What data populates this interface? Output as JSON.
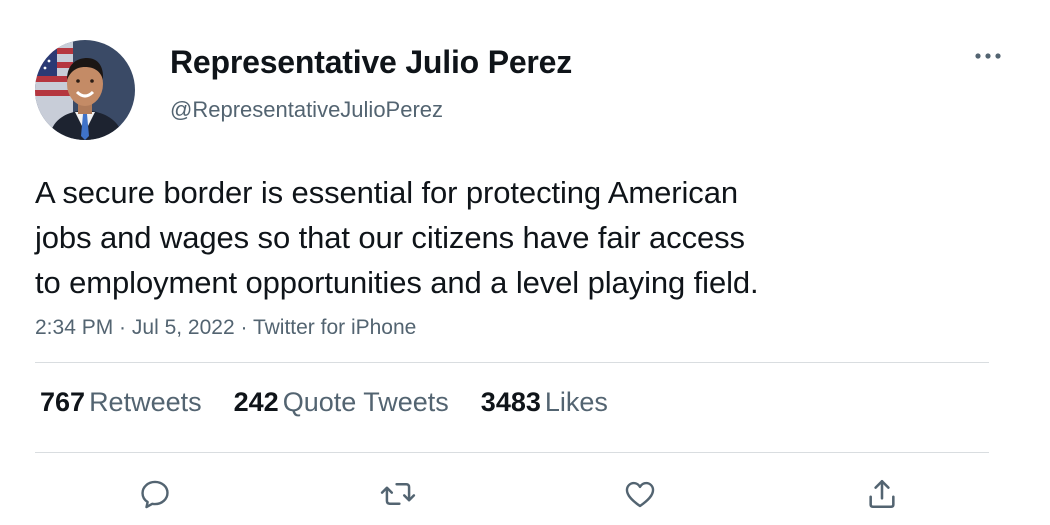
{
  "author": {
    "display_name": "Representative Julio Perez",
    "handle": "@RepresentativeJulioPerez",
    "avatar_icon": "profile-photo"
  },
  "tweet": {
    "text_lines": [
      "A secure border is essential for protecting American",
      "jobs and wages so that our citizens have fair access",
      "to employment opportunities and a level playing field."
    ],
    "time": "2:34 PM",
    "date": "Jul 5, 2022",
    "source": "Twitter for iPhone",
    "separator": " · "
  },
  "stats": {
    "retweets_count": "767",
    "retweets_label": "Retweets",
    "quotes_count": "242",
    "quotes_label": "Quote Tweets",
    "likes_count": "3483",
    "likes_label": "Likes"
  },
  "icons": {
    "more": "more-horizontal-icon",
    "reply": "reply-icon",
    "retweet": "retweet-icon",
    "like": "heart-icon",
    "share": "share-icon"
  },
  "colors": {
    "text_primary": "#0f1419",
    "text_secondary": "#536471",
    "divider": "#d9dde0",
    "icon": "#536471"
  }
}
